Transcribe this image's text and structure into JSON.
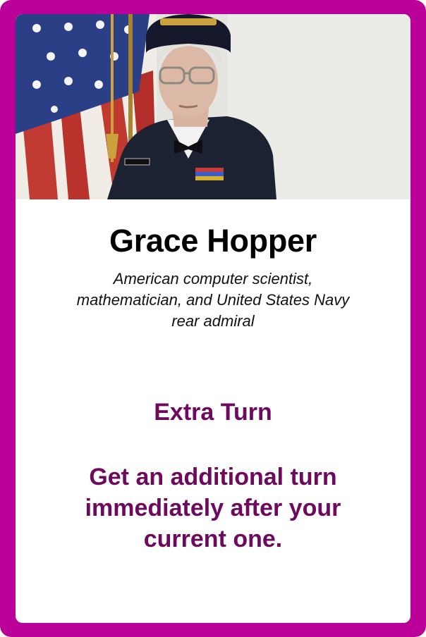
{
  "card": {
    "name": "Grace Hopper",
    "description": "American computer scientist, mathematician, and United States Navy rear admiral",
    "ability_title": "Extra Turn",
    "ability_text": "Get an additional turn immediately after your current one.",
    "portrait_icon": "portrait-photo",
    "colors": {
      "border": "#bb0099",
      "ability_text": "#6e0a5e"
    }
  }
}
